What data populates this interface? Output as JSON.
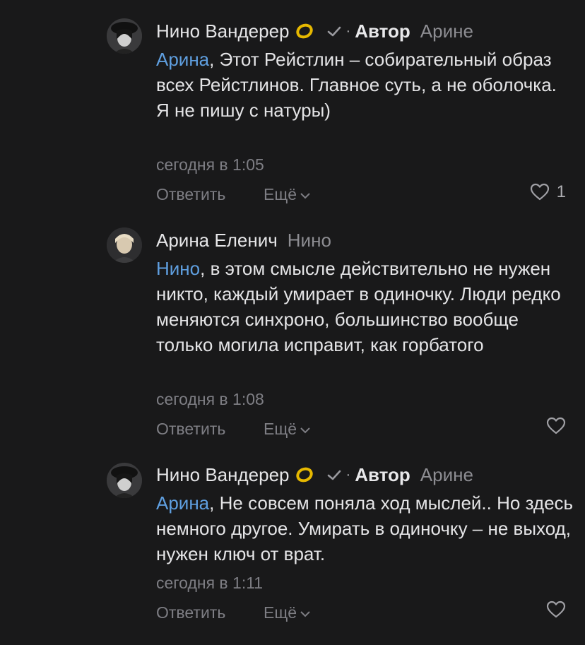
{
  "comments": [
    {
      "author": "Нино Вандерер",
      "badge": "Автор",
      "reply_to": "Арине",
      "mention": "Арина",
      "text_after_mention": ", Этот Рейстлин – собирательный образ всех Рейстлинов. Главное суть, а не оболочка.",
      "text_line2": "Я не пишу с натуры)",
      "time": "сегодня в 1:05",
      "reply_label": "Ответить",
      "more_label": "Ещё",
      "likes": "1"
    },
    {
      "author": "Арина Еленич",
      "reply_to": "Нино",
      "mention": "Нино",
      "text_after_mention": ", в этом смысле действительно не нужен никто, каждый умирает в одиночку. Люди редко меняются синхроно, большинство вообще только могила исправит, как горбатого",
      "time": "сегодня в 1:08",
      "reply_label": "Ответить",
      "more_label": "Ещё"
    },
    {
      "author": "Нино Вандерер",
      "badge": "Автор",
      "reply_to": "Арине",
      "mention": "Арина",
      "text_after_mention": ", Не совсем поняла ход мыслей.. Но здесь немного другое. Умирать в одиночку – не выход, нужен ключ от врат.",
      "time": "сегодня в 1:11",
      "reply_label": "Ответить",
      "more_label": "Ещё"
    }
  ],
  "icons": {
    "ring": "gold-ring-icon",
    "check": "checkmark-icon",
    "heart": "heart-outline-icon",
    "chevron": "chevron-down-icon"
  },
  "colors": {
    "background": "#19191a",
    "mention": "#5f9fe0",
    "muted": "#7e7e84",
    "ring": "#e6b800"
  }
}
